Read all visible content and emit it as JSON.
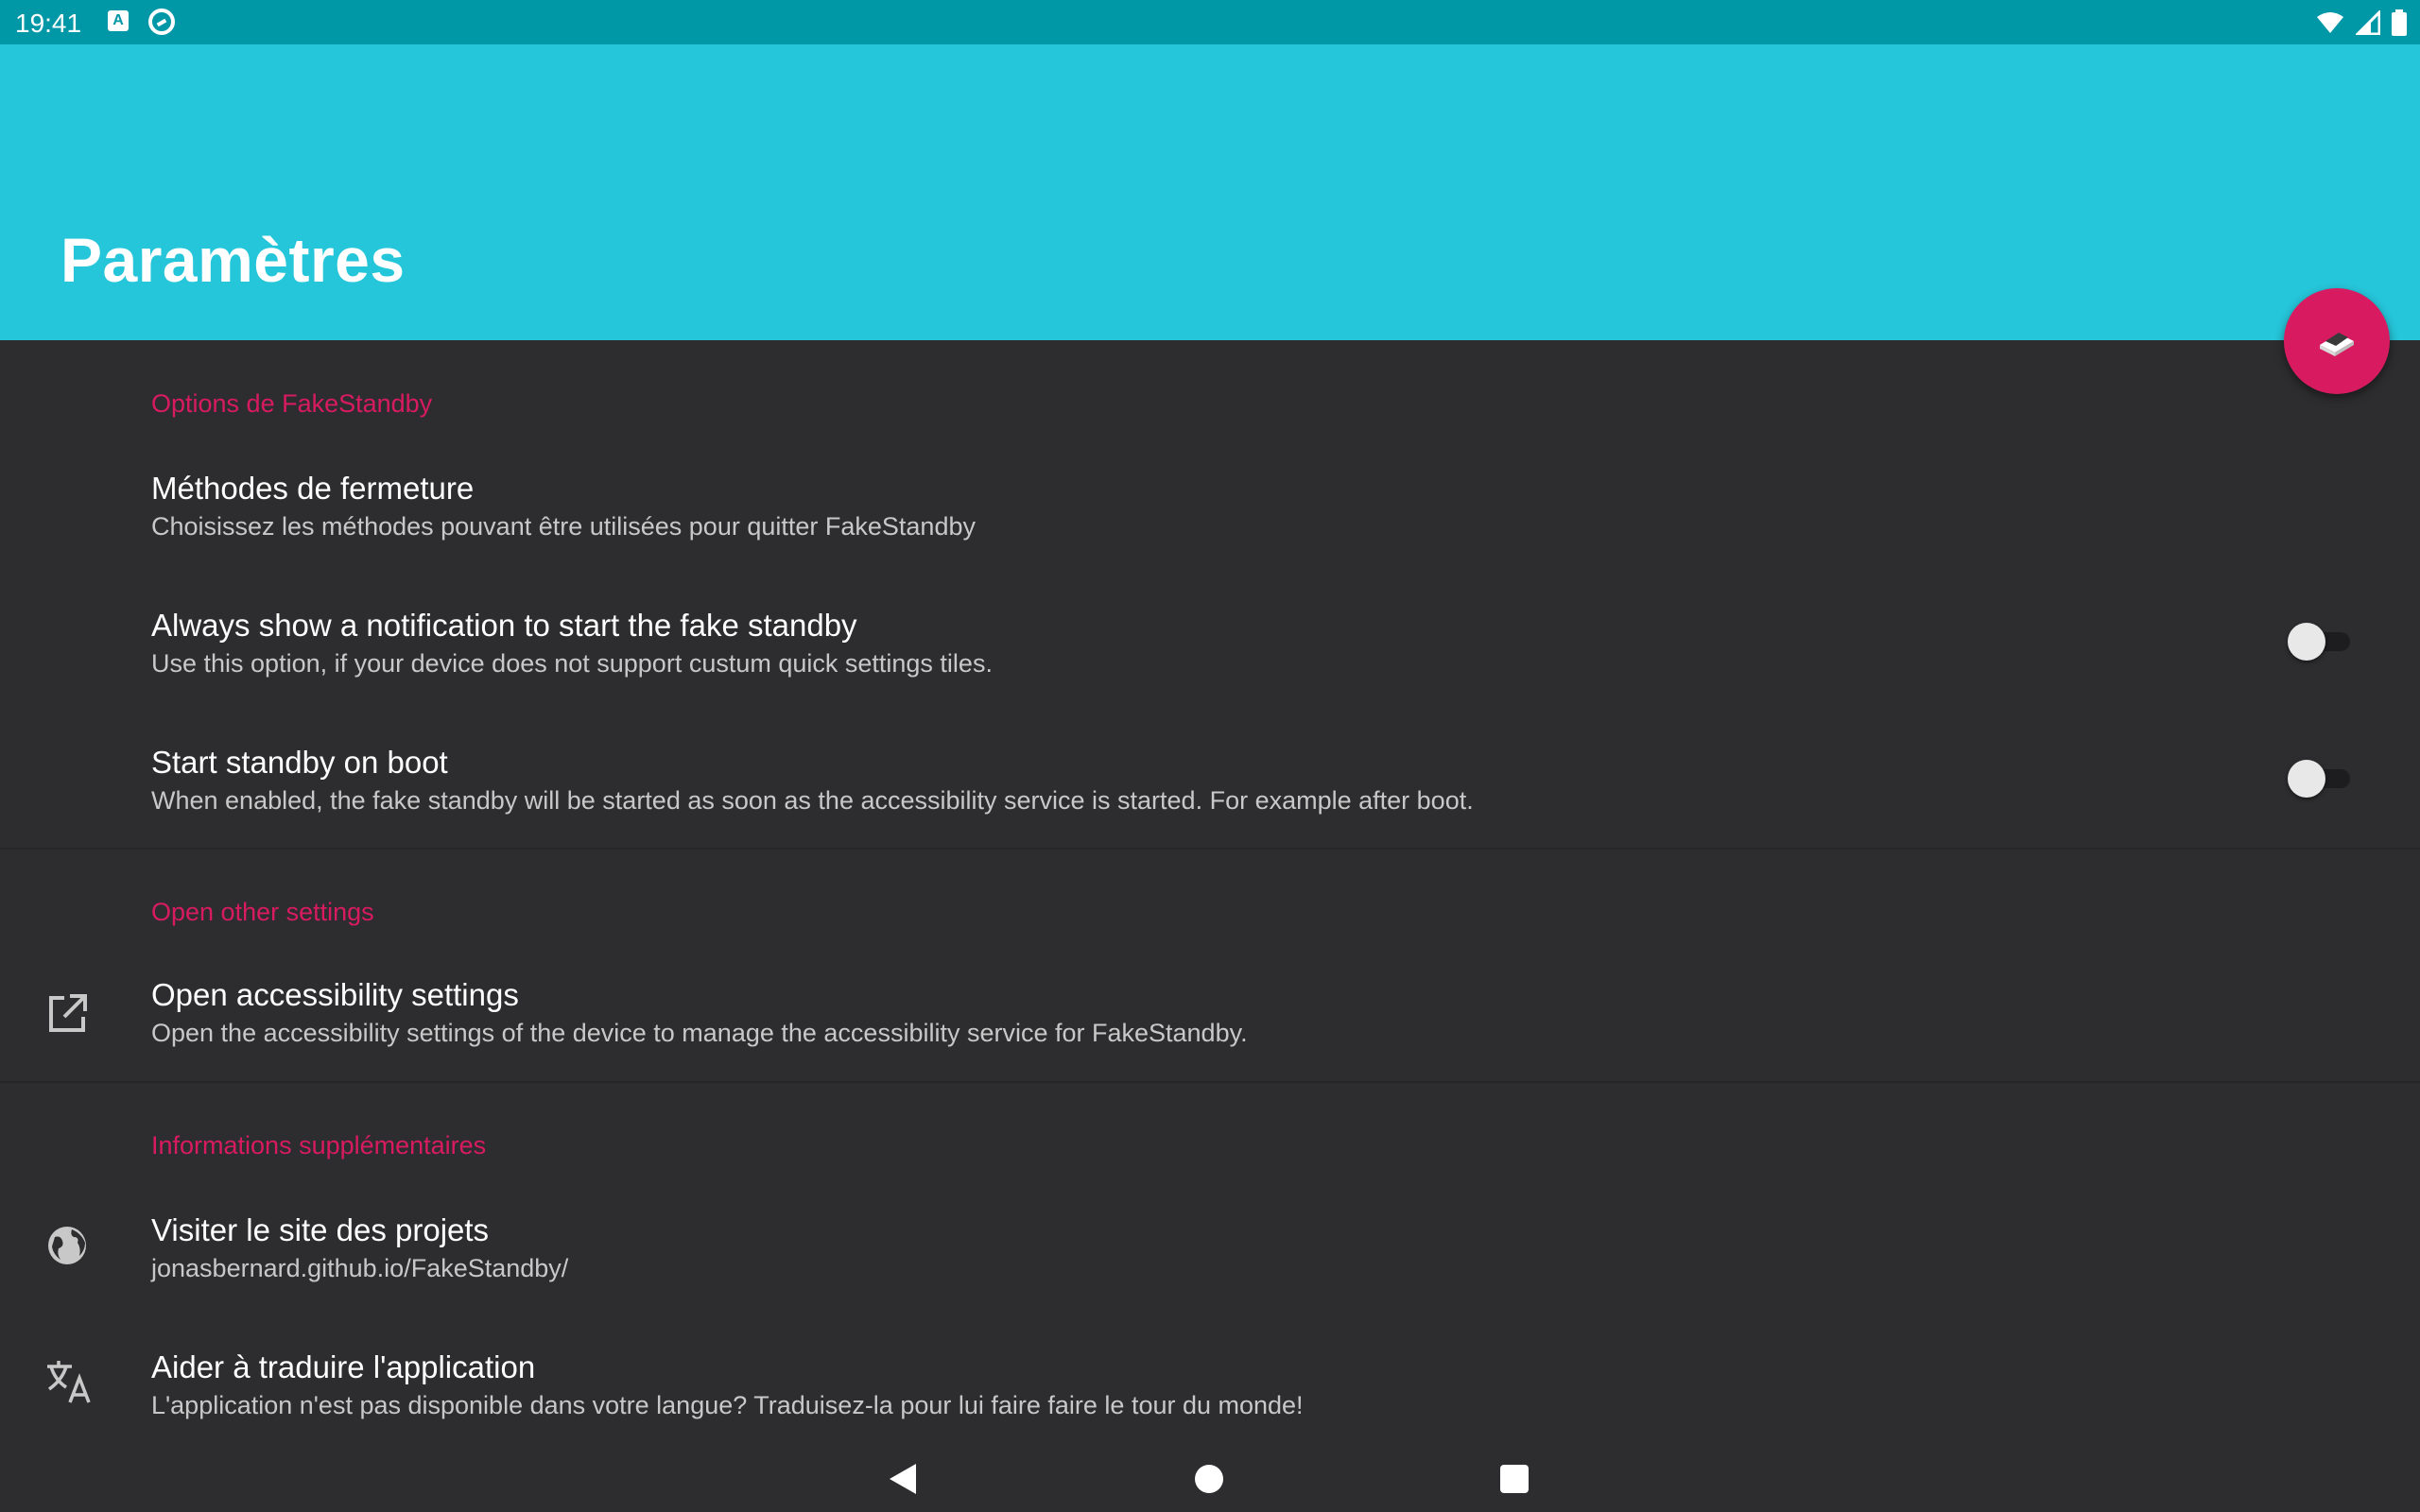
{
  "status_bar": {
    "time": "19:41",
    "left_icons": [
      "a-notification-icon",
      "sync-icon"
    ],
    "right_icons": [
      "wifi-icon",
      "signal-icon",
      "battery-icon"
    ]
  },
  "app_bar": {
    "title": "Paramètres",
    "background_color": "#26c6da"
  },
  "fab": {
    "icon": "standby-icon",
    "color": "#d81b60"
  },
  "sections": {
    "options": {
      "header": "Options de FakeStandby",
      "closing_methods": {
        "title": "Méthodes de fermeture",
        "summary": "Choisissez les méthodes pouvant être utilisées pour quitter FakeStandby"
      },
      "always_notification": {
        "title": "Always show a notification to start the fake standby",
        "summary": "Use this option, if your device does not support custum quick settings tiles.",
        "enabled": false
      },
      "standby_on_boot": {
        "title": "Start standby on boot",
        "summary": "When enabled, the fake standby will be started as soon as the accessibility service is started. For example after boot.",
        "enabled": false
      }
    },
    "other": {
      "header": "Open other settings",
      "accessibility": {
        "icon": "open-external-icon",
        "title": "Open accessibility settings",
        "summary": "Open the accessibility settings of the device to manage the accessibility service for FakeStandby."
      }
    },
    "info": {
      "header": "Informations supplémentaires",
      "website": {
        "icon": "globe-icon",
        "title": "Visiter le site des projets",
        "summary": "jonasbernard.github.io/FakeStandby/"
      },
      "translate": {
        "icon": "translate-icon",
        "title": "Aider à traduire l'application",
        "summary": "L'application n'est pas disponible dans votre langue? Traduisez-la pour lui faire faire le tour du monde!"
      }
    }
  },
  "nav_bar": {
    "buttons": [
      "back-icon",
      "home-icon",
      "recents-icon"
    ]
  },
  "colors": {
    "accent": "#d81b60",
    "status_bar": "#0097a7",
    "background": "#2d2d2f"
  }
}
